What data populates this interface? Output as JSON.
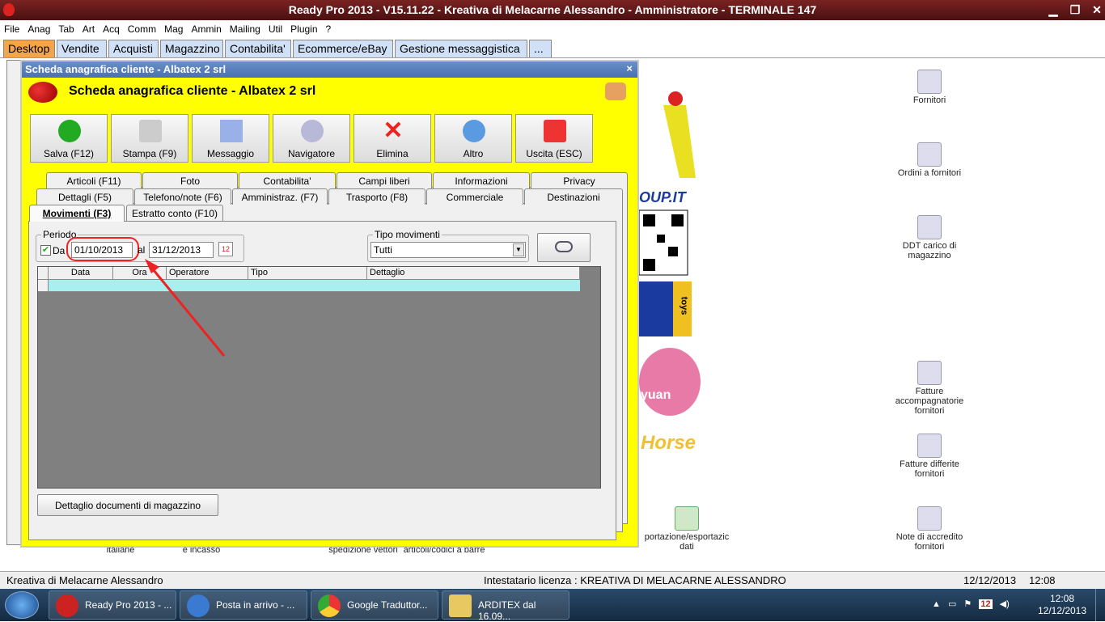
{
  "app": {
    "title": "Ready Pro 2013 - V15.11.22 - Kreativa di Melacarne Alessandro - Amministratore - TERMINALE 147"
  },
  "menu": [
    "File",
    "Anag",
    "Tab",
    "Art",
    "Acq",
    "Comm",
    "Mag",
    "Ammin",
    "Mailing",
    "Util",
    "Plugin",
    "?"
  ],
  "main_tabs": [
    "Desktop",
    "Vendite",
    "Acquisti",
    "Magazzino",
    "Contabilita'",
    "Ecommerce/eBay",
    "Gestione messaggistica",
    "..."
  ],
  "desktop_icons": [
    "Fornitori",
    "Ordini a fornitori",
    "DDT carico di magazzino",
    "Fatture accompagnatorie fornitori",
    "Fatture differite fornitori",
    "Note di accredito fornitori",
    "portazione/esportazic dati"
  ],
  "desktop_partial_labels": [
    "italiane",
    "e incasso",
    "spedizione vettori",
    "articoli/codici a barre"
  ],
  "logo_text": [
    "OUP.IT",
    "toys",
    "yuan",
    "Horse"
  ],
  "dialog": {
    "title": "Scheda anagrafica cliente - Albatex 2 srl",
    "heading": "Scheda anagrafica cliente - Albatex 2 srl",
    "close": "×",
    "toolbar": [
      "Salva (F12)",
      "Stampa (F9)",
      "Messaggio",
      "Navigatore",
      "Elimina",
      "Altro",
      "Uscita (ESC)"
    ],
    "tabs_row1": [
      "Articoli (F11)",
      "Foto",
      "Contabilita'",
      "Campi liberi",
      "Informazioni",
      "Privacy"
    ],
    "tabs_row2": [
      "Dettagli (F5)",
      "Telefono/note (F6)",
      "Amministraz. (F7)",
      "Trasporto (F8)",
      "Commerciale",
      "Destinazioni"
    ],
    "tabs_row3": [
      "Movimenti (F3)",
      "Estratto conto (F10)"
    ],
    "periodo": {
      "label": "Periodo",
      "da_label": "Da",
      "da_checked": true,
      "da_value": "01/10/2013",
      "al_label": "al",
      "al_value": "31/12/2013"
    },
    "tipo_movimenti": {
      "label": "Tipo movimenti",
      "value": "Tutti"
    },
    "grid_columns": [
      "Data",
      "Ora",
      "Operatore",
      "Tipo",
      "Dettaglio"
    ],
    "dettaglio_button": "Dettaglio documenti di magazzino"
  },
  "statusbar": {
    "left": "Kreativa di Melacarne Alessandro",
    "license": "Intestatario licenza : KREATIVA DI MELACARNE ALESSANDRO",
    "date": "12/12/2013",
    "time": "12:08"
  },
  "taskbar": {
    "items": [
      "Ready Pro 2013 - ...",
      "Posta in arrivo - ...",
      "Google Traduttor...",
      "ARDITEX dal 16.09..."
    ],
    "clock_time": "12:08",
    "clock_date": "12/12/2013",
    "tray_badge": "12"
  }
}
